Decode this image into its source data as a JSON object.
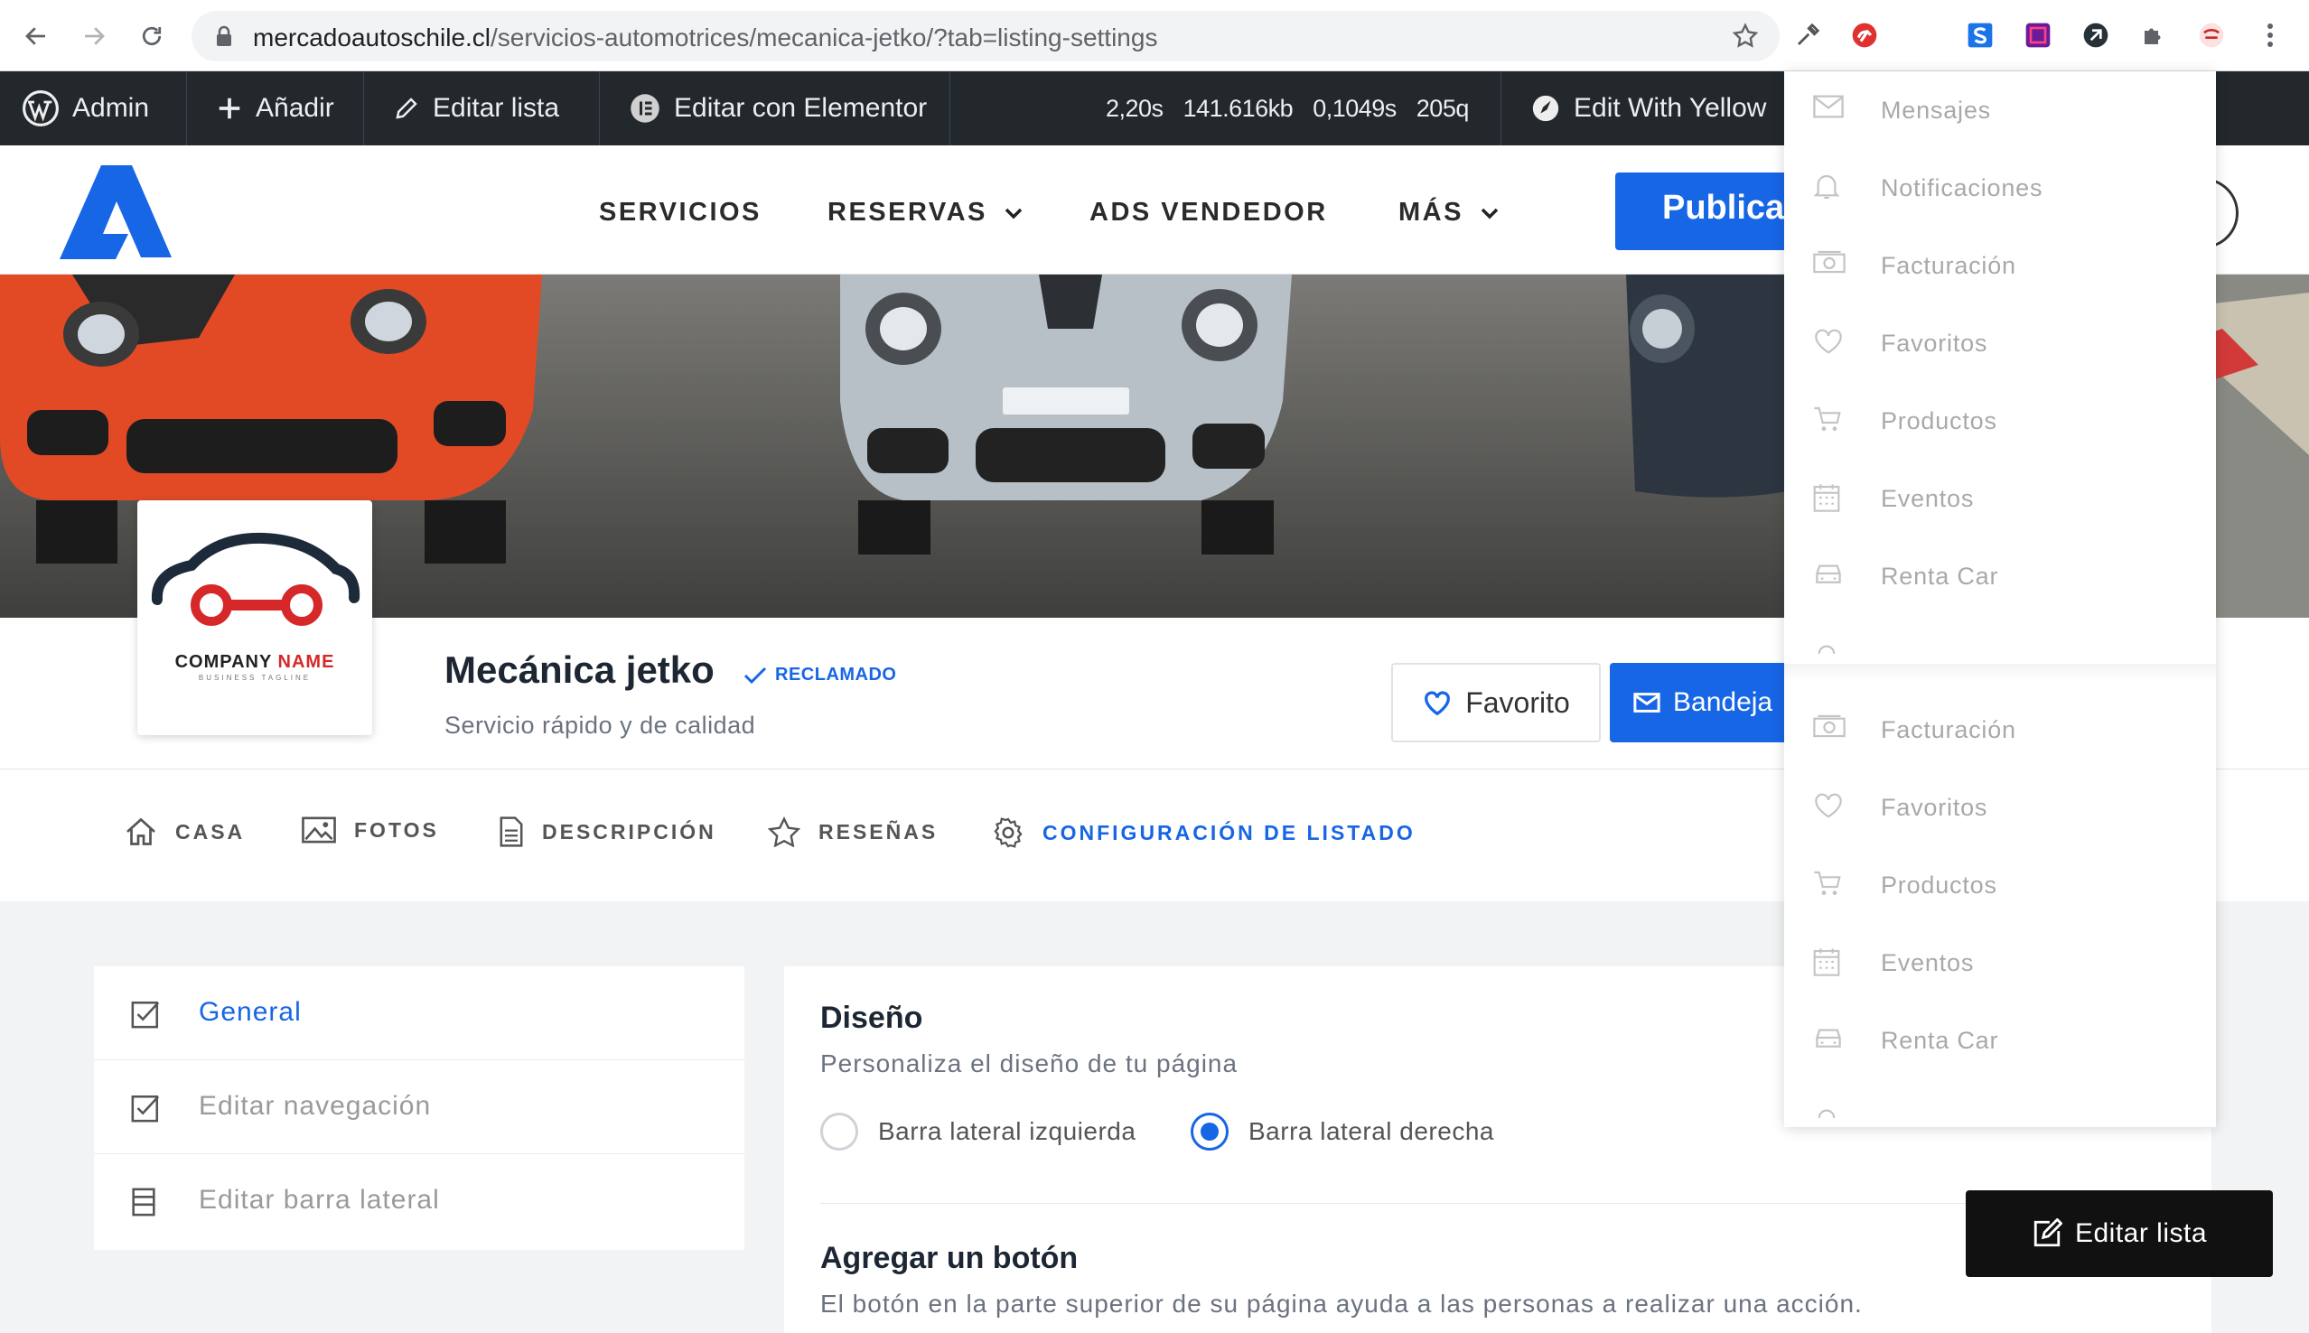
{
  "browser": {
    "url_domain": "mercadoautoschile.cl",
    "url_path": "/servicios-automotrices/mecanica-jetko/?tab=listing-settings"
  },
  "admin_bar": {
    "admin": "Admin",
    "add": "Añadir",
    "edit_listing": "Editar lista",
    "elementor": "Editar con Elementor",
    "stats": [
      "2,20s",
      "141.616kb",
      "0,1049s",
      "205q"
    ],
    "yellow_pencil": "Edit With Yellow"
  },
  "header": {
    "menu": [
      {
        "label": "SERVICIOS",
        "has_caret": false
      },
      {
        "label": "RESERVAS",
        "has_caret": true
      },
      {
        "label": "ADS VENDEDOR",
        "has_caret": false
      },
      {
        "label": "MÁS",
        "has_caret": true
      }
    ],
    "publish_label": "Publica",
    "accent": "#1766e6"
  },
  "listing": {
    "logo_word1": "COMPANY",
    "logo_word2": "NAME",
    "logo_tagline": "BUSINESS TAGLINE",
    "title": "Mecánica jetko",
    "claimed": "RECLAMADO",
    "subtitle": "Servicio rápido y de calidad",
    "favorite": "Favorito",
    "inbox": "Bandeja"
  },
  "tabs": [
    {
      "label": "CASA",
      "icon": "home-icon",
      "active": false
    },
    {
      "label": "FOTOS",
      "icon": "image-icon",
      "active": false
    },
    {
      "label": "DESCRIPCIÓN",
      "icon": "document-icon",
      "active": false
    },
    {
      "label": "RESEÑAS",
      "icon": "star-icon",
      "active": false
    },
    {
      "label": "CONFIGURACIÓN DE LISTADO",
      "icon": "gear-icon",
      "active": true
    }
  ],
  "settings_nav": [
    {
      "label": "General",
      "icon": "checkbox-icon",
      "active": true
    },
    {
      "label": "Editar navegación",
      "icon": "checkbox-icon",
      "active": false
    },
    {
      "label": "Editar barra lateral",
      "icon": "sidebar-icon",
      "active": false
    }
  ],
  "design": {
    "heading": "Diseño",
    "description": "Personaliza el diseño de tu página",
    "option_left": "Barra lateral izquierda",
    "option_right": "Barra lateral derecha",
    "selected": "right"
  },
  "add_button": {
    "heading": "Agregar un botón",
    "description": "El botón en la parte superior de su página ayuda a las personas a realizar una acción."
  },
  "floating_edit": "Editar lista",
  "user_dropdown": {
    "first_block": [
      {
        "label": "Mensajes",
        "icon": "mail-icon"
      },
      {
        "label": "Notificaciones",
        "icon": "bell-icon"
      },
      {
        "label": "Facturación",
        "icon": "money-icon"
      },
      {
        "label": "Favoritos",
        "icon": "heart-icon"
      },
      {
        "label": "Productos",
        "icon": "cart-icon"
      },
      {
        "label": "Eventos",
        "icon": "calendar-icon"
      },
      {
        "label": "Renta Car",
        "icon": "car-icon"
      }
    ],
    "second_block": [
      {
        "label": "Facturación",
        "icon": "money-icon"
      },
      {
        "label": "Favoritos",
        "icon": "heart-icon"
      },
      {
        "label": "Productos",
        "icon": "cart-icon"
      },
      {
        "label": "Eventos",
        "icon": "calendar-icon"
      },
      {
        "label": "Renta Car",
        "icon": "car-icon"
      }
    ]
  }
}
